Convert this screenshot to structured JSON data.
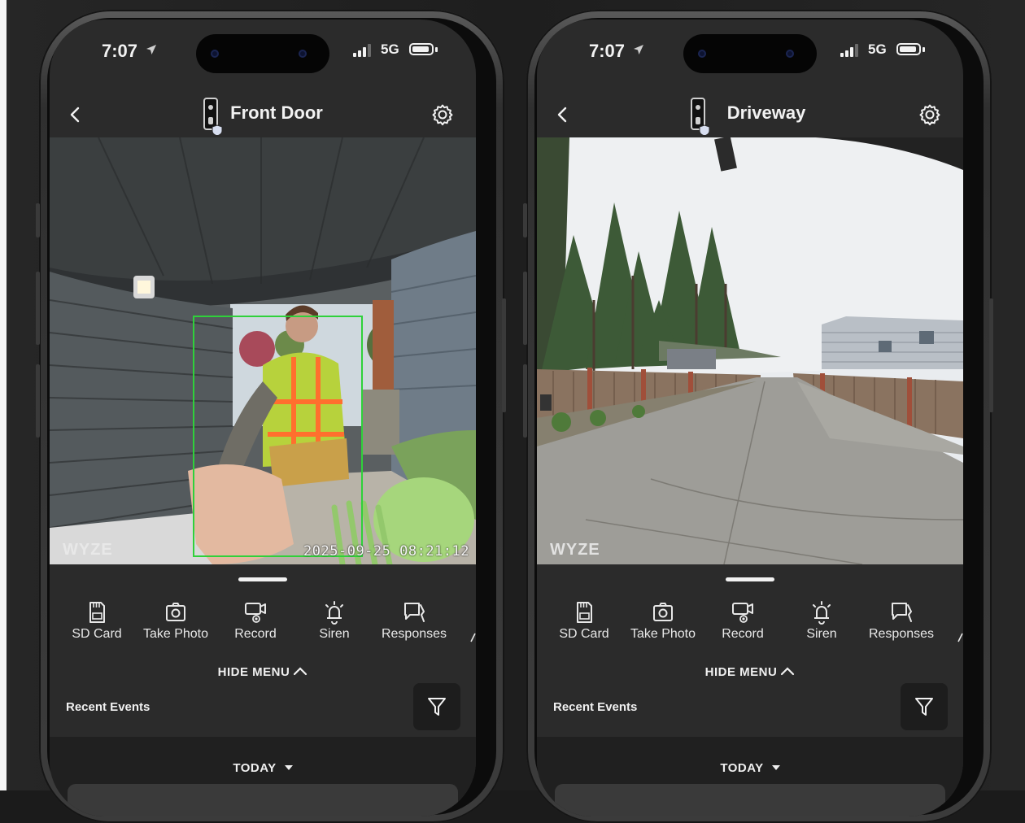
{
  "phones": [
    {
      "status": {
        "time": "7:07",
        "network": "5G"
      },
      "camera_title": "Front Door",
      "feed": {
        "watermark": "WYZE",
        "timestamp": "2025-09-25 08:21:12"
      },
      "menu": [
        {
          "label": "SD Card",
          "icon": "sd-card-icon"
        },
        {
          "label": "Take Photo",
          "icon": "camera-icon"
        },
        {
          "label": "Record",
          "icon": "record-icon"
        },
        {
          "label": "Siren",
          "icon": "siren-icon"
        },
        {
          "label": "Responses",
          "icon": "responses-icon"
        }
      ],
      "hide_menu": "HIDE MENU",
      "recent_events": "Recent Events",
      "day_filter": "TODAY"
    },
    {
      "status": {
        "time": "7:07",
        "network": "5G"
      },
      "camera_title": "Driveway",
      "feed": {
        "watermark": "WYZE",
        "timestamp": ""
      },
      "menu": [
        {
          "label": "SD Card",
          "icon": "sd-card-icon"
        },
        {
          "label": "Take Photo",
          "icon": "camera-icon"
        },
        {
          "label": "Record",
          "icon": "record-icon"
        },
        {
          "label": "Siren",
          "icon": "siren-icon"
        },
        {
          "label": "Responses",
          "icon": "responses-icon"
        }
      ],
      "hide_menu": "HIDE MENU",
      "recent_events": "Recent Events",
      "day_filter": "TODAY"
    }
  ],
  "colors": {
    "screen_bg": "#2b2b2b",
    "detection_box": "#2fd13a",
    "text": "#f2f2f2"
  }
}
